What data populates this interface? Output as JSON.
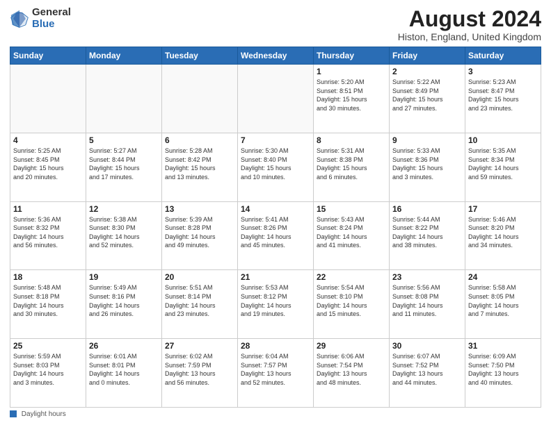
{
  "header": {
    "logo_general": "General",
    "logo_blue": "Blue",
    "title": "August 2024",
    "location": "Histon, England, United Kingdom"
  },
  "footer": {
    "label": "Daylight hours"
  },
  "weekdays": [
    "Sunday",
    "Monday",
    "Tuesday",
    "Wednesday",
    "Thursday",
    "Friday",
    "Saturday"
  ],
  "weeks": [
    [
      {
        "day": "",
        "info": ""
      },
      {
        "day": "",
        "info": ""
      },
      {
        "day": "",
        "info": ""
      },
      {
        "day": "",
        "info": ""
      },
      {
        "day": "1",
        "info": "Sunrise: 5:20 AM\nSunset: 8:51 PM\nDaylight: 15 hours\nand 30 minutes."
      },
      {
        "day": "2",
        "info": "Sunrise: 5:22 AM\nSunset: 8:49 PM\nDaylight: 15 hours\nand 27 minutes."
      },
      {
        "day": "3",
        "info": "Sunrise: 5:23 AM\nSunset: 8:47 PM\nDaylight: 15 hours\nand 23 minutes."
      }
    ],
    [
      {
        "day": "4",
        "info": "Sunrise: 5:25 AM\nSunset: 8:45 PM\nDaylight: 15 hours\nand 20 minutes."
      },
      {
        "day": "5",
        "info": "Sunrise: 5:27 AM\nSunset: 8:44 PM\nDaylight: 15 hours\nand 17 minutes."
      },
      {
        "day": "6",
        "info": "Sunrise: 5:28 AM\nSunset: 8:42 PM\nDaylight: 15 hours\nand 13 minutes."
      },
      {
        "day": "7",
        "info": "Sunrise: 5:30 AM\nSunset: 8:40 PM\nDaylight: 15 hours\nand 10 minutes."
      },
      {
        "day": "8",
        "info": "Sunrise: 5:31 AM\nSunset: 8:38 PM\nDaylight: 15 hours\nand 6 minutes."
      },
      {
        "day": "9",
        "info": "Sunrise: 5:33 AM\nSunset: 8:36 PM\nDaylight: 15 hours\nand 3 minutes."
      },
      {
        "day": "10",
        "info": "Sunrise: 5:35 AM\nSunset: 8:34 PM\nDaylight: 14 hours\nand 59 minutes."
      }
    ],
    [
      {
        "day": "11",
        "info": "Sunrise: 5:36 AM\nSunset: 8:32 PM\nDaylight: 14 hours\nand 56 minutes."
      },
      {
        "day": "12",
        "info": "Sunrise: 5:38 AM\nSunset: 8:30 PM\nDaylight: 14 hours\nand 52 minutes."
      },
      {
        "day": "13",
        "info": "Sunrise: 5:39 AM\nSunset: 8:28 PM\nDaylight: 14 hours\nand 49 minutes."
      },
      {
        "day": "14",
        "info": "Sunrise: 5:41 AM\nSunset: 8:26 PM\nDaylight: 14 hours\nand 45 minutes."
      },
      {
        "day": "15",
        "info": "Sunrise: 5:43 AM\nSunset: 8:24 PM\nDaylight: 14 hours\nand 41 minutes."
      },
      {
        "day": "16",
        "info": "Sunrise: 5:44 AM\nSunset: 8:22 PM\nDaylight: 14 hours\nand 38 minutes."
      },
      {
        "day": "17",
        "info": "Sunrise: 5:46 AM\nSunset: 8:20 PM\nDaylight: 14 hours\nand 34 minutes."
      }
    ],
    [
      {
        "day": "18",
        "info": "Sunrise: 5:48 AM\nSunset: 8:18 PM\nDaylight: 14 hours\nand 30 minutes."
      },
      {
        "day": "19",
        "info": "Sunrise: 5:49 AM\nSunset: 8:16 PM\nDaylight: 14 hours\nand 26 minutes."
      },
      {
        "day": "20",
        "info": "Sunrise: 5:51 AM\nSunset: 8:14 PM\nDaylight: 14 hours\nand 23 minutes."
      },
      {
        "day": "21",
        "info": "Sunrise: 5:53 AM\nSunset: 8:12 PM\nDaylight: 14 hours\nand 19 minutes."
      },
      {
        "day": "22",
        "info": "Sunrise: 5:54 AM\nSunset: 8:10 PM\nDaylight: 14 hours\nand 15 minutes."
      },
      {
        "day": "23",
        "info": "Sunrise: 5:56 AM\nSunset: 8:08 PM\nDaylight: 14 hours\nand 11 minutes."
      },
      {
        "day": "24",
        "info": "Sunrise: 5:58 AM\nSunset: 8:05 PM\nDaylight: 14 hours\nand 7 minutes."
      }
    ],
    [
      {
        "day": "25",
        "info": "Sunrise: 5:59 AM\nSunset: 8:03 PM\nDaylight: 14 hours\nand 3 minutes."
      },
      {
        "day": "26",
        "info": "Sunrise: 6:01 AM\nSunset: 8:01 PM\nDaylight: 14 hours\nand 0 minutes."
      },
      {
        "day": "27",
        "info": "Sunrise: 6:02 AM\nSunset: 7:59 PM\nDaylight: 13 hours\nand 56 minutes."
      },
      {
        "day": "28",
        "info": "Sunrise: 6:04 AM\nSunset: 7:57 PM\nDaylight: 13 hours\nand 52 minutes."
      },
      {
        "day": "29",
        "info": "Sunrise: 6:06 AM\nSunset: 7:54 PM\nDaylight: 13 hours\nand 48 minutes."
      },
      {
        "day": "30",
        "info": "Sunrise: 6:07 AM\nSunset: 7:52 PM\nDaylight: 13 hours\nand 44 minutes."
      },
      {
        "day": "31",
        "info": "Sunrise: 6:09 AM\nSunset: 7:50 PM\nDaylight: 13 hours\nand 40 minutes."
      }
    ]
  ]
}
